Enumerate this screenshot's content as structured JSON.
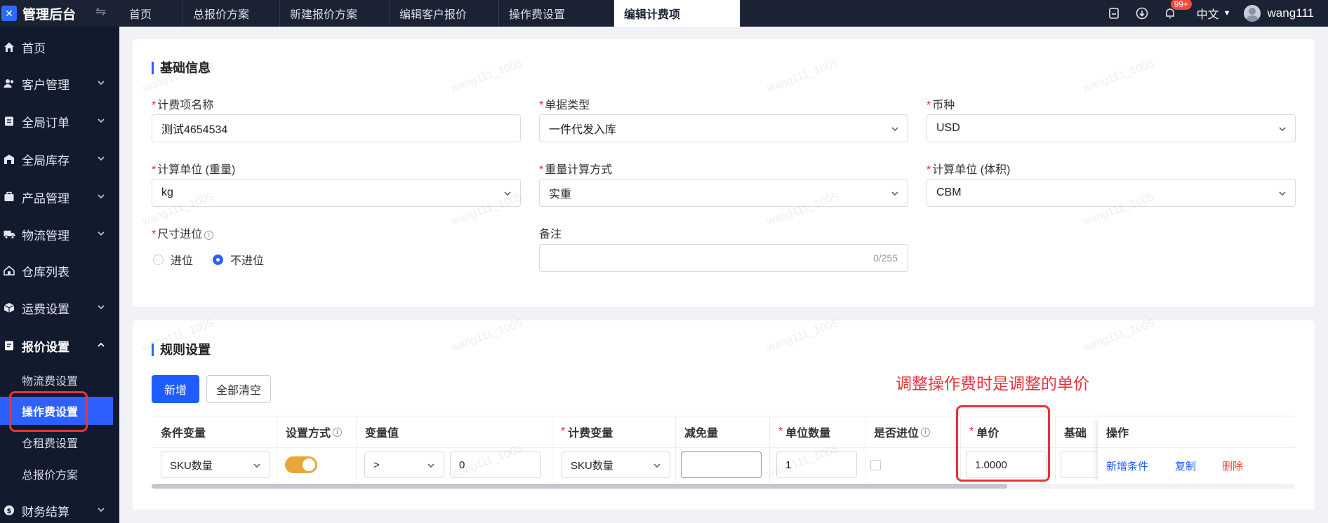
{
  "app": {
    "logo_text": "管理后台",
    "collapse_icon": "collapse-icon"
  },
  "tabs": [
    {
      "label": "首页"
    },
    {
      "label": "总报价方案"
    },
    {
      "label": "新建报价方案"
    },
    {
      "label": "编辑客户报价"
    },
    {
      "label": "操作费设置"
    },
    {
      "label": "编辑计费项"
    }
  ],
  "header": {
    "notification_badge": "99+",
    "language": "中文",
    "username": "wang111"
  },
  "sidebar": {
    "items": [
      {
        "label": "首页",
        "icon": "home-icon"
      },
      {
        "label": "客户管理",
        "icon": "users-icon"
      },
      {
        "label": "全局订单",
        "icon": "order-icon"
      },
      {
        "label": "全局库存",
        "icon": "warehouse-icon"
      },
      {
        "label": "产品管理",
        "icon": "product-icon"
      },
      {
        "label": "物流管理",
        "icon": "truck-icon"
      },
      {
        "label": "仓库列表",
        "icon": "house-icon"
      },
      {
        "label": "运费设置",
        "icon": "box-icon"
      },
      {
        "label": "报价设置",
        "icon": "document-icon"
      },
      {
        "label": "财务结算",
        "icon": "finance-icon"
      }
    ],
    "sub_items": [
      {
        "label": "物流费设置"
      },
      {
        "label": "操作费设置"
      },
      {
        "label": "仓租费设置"
      },
      {
        "label": "总报价方案"
      }
    ]
  },
  "basic": {
    "title": "基础信息",
    "fields": {
      "fee_name": {
        "label": "计费项名称",
        "value": "测试4654534"
      },
      "doc_type": {
        "label": "单据类型",
        "value": "一件代发入库"
      },
      "currency": {
        "label": "币种",
        "value": "USD"
      },
      "weight_unit": {
        "label": "计算单位 (重量)",
        "value": "kg"
      },
      "weight_method": {
        "label": "重量计算方式",
        "value": "实重"
      },
      "volume_unit": {
        "label": "计算单位 (体积)",
        "value": "CBM"
      },
      "size_rounding": {
        "label": "尺寸进位",
        "options": [
          "进位",
          "不进位"
        ],
        "selected": "不进位"
      },
      "remark": {
        "label": "备注",
        "value": "",
        "counter": "0/255"
      }
    }
  },
  "rules": {
    "title": "规则设置",
    "add_label": "新增",
    "clear_label": "全部清空",
    "annotation": "调整操作费时是调整的单价",
    "columns": [
      "条件变量",
      "设置方式",
      "变量值",
      "计费变量",
      "减免量",
      "单位数量",
      "是否进位",
      "单价",
      "基础",
      "操作"
    ],
    "row": {
      "condition_var": "SKU数量",
      "mode_enabled": true,
      "operator": ">",
      "var_value": "0",
      "charge_var": "SKU数量",
      "exemption": "",
      "unit_qty": "1",
      "rounding": false,
      "unit_price": "1.0000",
      "ops": [
        "新增条件",
        "复制",
        "删除"
      ]
    }
  },
  "watermark": "wang111_1005",
  "colors": {
    "accent": "#1f5cff",
    "sidebar_bg": "#121b2e",
    "topbar_bg": "#1a2233",
    "annotation": "#e8333b",
    "toggle": "#e9a73a"
  }
}
